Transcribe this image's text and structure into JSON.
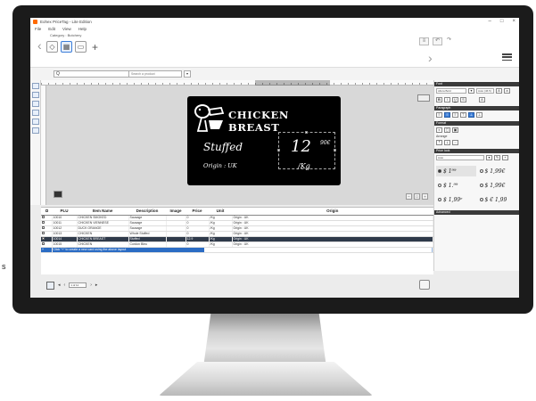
{
  "app": {
    "title": "Eohex PriceTag - Lite Edition",
    "menu": [
      "File",
      "Edit",
      "View",
      "Help"
    ],
    "category_label": "Category : Butchery"
  },
  "search": {
    "value": "Q",
    "placeholder": "Search a product",
    "dropdown": "▾"
  },
  "label": {
    "title": "CHICKEN BREAST",
    "subtitle": "Stuffed",
    "origin": "Origin : UK",
    "price": "12",
    "cents": "90€",
    "unit": "/Kg"
  },
  "table": {
    "headers": [
      "PLU",
      "Item Name",
      "Description",
      "Image",
      "Price",
      "Unit",
      "Origin"
    ],
    "rows": [
      {
        "plu": "10010",
        "name": "CHICKEN SMOKED",
        "desc": "Sausage",
        "price": "0",
        "unit": "/Kg",
        "origin": "Origin : UK",
        "selected": false
      },
      {
        "plu": "10011",
        "name": "CHICKEN VIENNESE",
        "desc": "Sausage",
        "price": "0",
        "unit": "/Kg",
        "origin": "Origin : UK",
        "selected": false
      },
      {
        "plu": "10012",
        "name": "DUCK ORANGE",
        "desc": "Sausage",
        "price": "0",
        "unit": "/Kg",
        "origin": "Origin : UK",
        "selected": false
      },
      {
        "plu": "10013",
        "name": "CHICKEN",
        "desc": "Whole Stuffed",
        "price": "0",
        "unit": "/Kg",
        "origin": "Origin : UK",
        "selected": false
      },
      {
        "plu": "10014",
        "name": "CHICKEN BREAST",
        "desc": "Stuffed",
        "price": "12.9",
        "unit": "/Kg",
        "origin": "Origin : UK",
        "selected": true
      },
      {
        "plu": "10015",
        "name": "CHICKEN",
        "desc": "Cordon Bleu",
        "price": "0",
        "unit": "/Kg",
        "origin": "Origin : UK",
        "selected": false
      }
    ],
    "new_row_hint": "Click \"+\" to create a new card using the above layout",
    "pager": "1 of 11"
  },
  "panel": {
    "sections": [
      "Font",
      "Paragraph",
      "Format",
      "Arrange",
      "Price look",
      "Advanced"
    ],
    "font_name": "Allura Bold",
    "font_size": "Auto (46.5)",
    "price_look_select": "Auto",
    "price_styles": [
      "$ 1⁹⁹",
      "$ 1,99€",
      "$ 1.⁹⁹",
      "$ 1,99€",
      "$ 1,99ᵉ",
      "$ € 1,99"
    ]
  },
  "colors": {
    "label_bg": "#000000",
    "selected_row": "#2f3a4a",
    "new_row": "#2b6cc4",
    "accent": "#ff6a00"
  }
}
